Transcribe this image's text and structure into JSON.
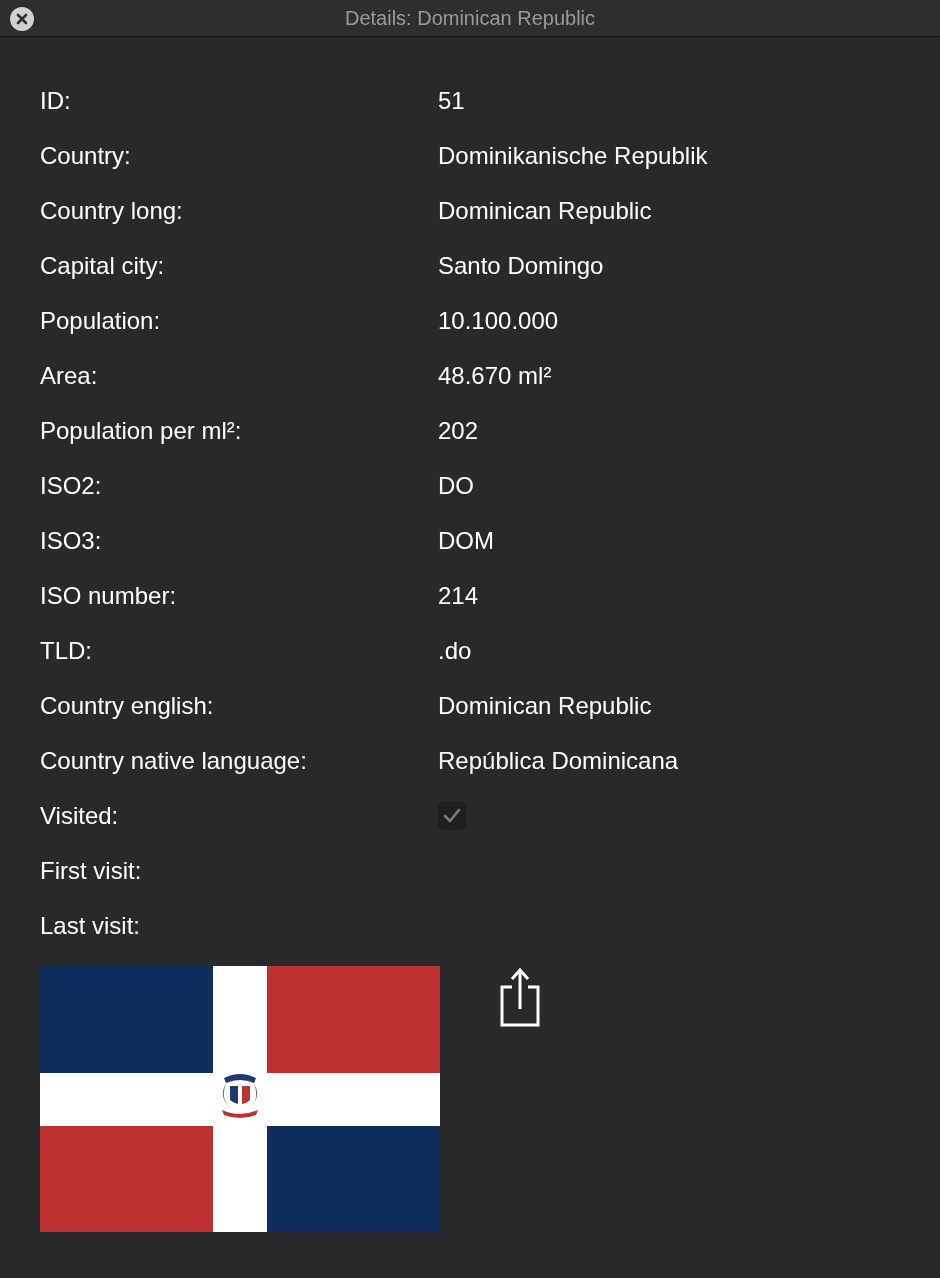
{
  "window": {
    "title": "Details: Dominican Republic"
  },
  "fields": [
    {
      "kind": "text",
      "label": "ID:",
      "value": "51"
    },
    {
      "kind": "text",
      "label": "Country:",
      "value": "Dominikanische Republik"
    },
    {
      "kind": "text",
      "label": "Country long:",
      "value": "Dominican Republic"
    },
    {
      "kind": "text",
      "label": "Capital city:",
      "value": "Santo Domingo"
    },
    {
      "kind": "text",
      "label": "Population:",
      "value": "10.100.000"
    },
    {
      "kind": "text",
      "label": "Area:",
      "value": "48.670 ml²"
    },
    {
      "kind": "text",
      "label": "Population per ml²:",
      "value": "202"
    },
    {
      "kind": "text",
      "label": "ISO2:",
      "value": "DO"
    },
    {
      "kind": "text",
      "label": "ISO3:",
      "value": "DOM"
    },
    {
      "kind": "text",
      "label": "ISO number:",
      "value": "214"
    },
    {
      "kind": "text",
      "label": "TLD:",
      "value": ".do"
    },
    {
      "kind": "text",
      "label": "Country english:",
      "value": "Dominican Republic"
    },
    {
      "kind": "text",
      "label": "Country native language:",
      "value": "República Dominicana"
    },
    {
      "kind": "checkbox",
      "label": "Visited:",
      "checked": true,
      "disabled": true
    },
    {
      "kind": "text",
      "label": "First visit:"
    },
    {
      "kind": "text",
      "label": "Last visit:"
    }
  ]
}
